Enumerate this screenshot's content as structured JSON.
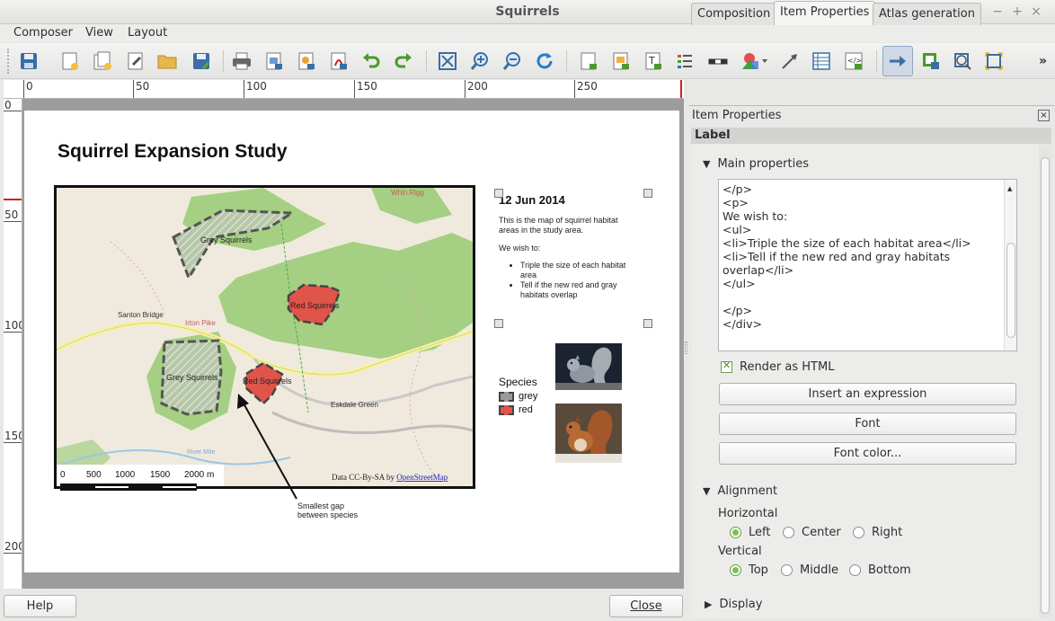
{
  "window": {
    "title": "Squirrels",
    "controls": [
      "−",
      "+",
      "×"
    ]
  },
  "menubar": [
    "Composer",
    "View",
    "Layout"
  ],
  "toolbar_icons": [
    "save-icon",
    "new-composer-icon",
    "duplicate-composer-icon",
    "composer-manager-icon",
    "open-template-icon",
    "save-template-icon",
    "print-icon",
    "export-image-icon",
    "export-svg-icon",
    "export-pdf-icon",
    "undo-icon",
    "redo-icon",
    "zoom-full-icon",
    "zoom-in-icon",
    "zoom-out-icon",
    "refresh-icon",
    "add-map-icon",
    "add-image-icon",
    "add-label-icon",
    "add-legend-icon",
    "add-scalebar-icon",
    "add-shape-icon",
    "add-arrow-icon",
    "add-table-icon",
    "add-html-icon",
    "select-move-item-icon",
    "move-content-icon",
    "edit-nodes-icon",
    "pan-icon",
    "more-icon"
  ],
  "ruler": {
    "h": [
      "0",
      "50",
      "100",
      "150",
      "200",
      "250"
    ],
    "v": [
      "0",
      "50",
      "100",
      "150",
      "200"
    ]
  },
  "composition": {
    "title": "Squirrel Expansion Study",
    "map": {
      "labels": {
        "whin_rigg": "Whin Rigg",
        "grey1": "Grey Squirrels",
        "red1": "Red Squirrels",
        "santon": "Santon Bridge",
        "irton": "Irton Pike",
        "grey2": "Grey Squirrels",
        "red2": "Red Squirrels",
        "eskdale": "Eskdale Green",
        "river": "River Mite"
      },
      "attribution_prefix": "Data CC-By-SA by ",
      "attribution_link": "OpenStreetMap",
      "scalebar": [
        "0",
        "500",
        "1000",
        "1500",
        "2000 m"
      ]
    },
    "label": {
      "date": "12 Jun 2014",
      "intro": "This is the map of squirrel habitat areas in the study area.",
      "wish": "We wish to:",
      "items": [
        "Triple the size of each habitat area",
        "Tell if the new red and gray habitats overlap"
      ]
    },
    "legend": {
      "title": "Species",
      "items": [
        {
          "label": "grey",
          "color": "#9a9a9a"
        },
        {
          "label": "red",
          "color": "#e0544a"
        }
      ]
    },
    "annotation": {
      "line1": "Smallest gap",
      "line2": "between species"
    }
  },
  "bottom": {
    "help": "Help",
    "close": "Close"
  },
  "panel": {
    "tabs": [
      "Composition",
      "Item Properties",
      "Atlas generation"
    ],
    "active_tab": "Item Properties",
    "header": "Item Properties",
    "section": "Label",
    "main_properties": "Main properties",
    "editor_lines": [
      "</p>",
      "<p>",
      "We wish to:",
      "<ul>",
      "<li>Triple the size of each habitat area</li>",
      "<li>Tell if the new red and gray habitats",
      "overlap</li>",
      "</ul>",
      "",
      "</p>",
      "</div>"
    ],
    "render_html": "Render as HTML",
    "render_html_checked": true,
    "insert_expression": "Insert an expression",
    "font": "Font",
    "font_color": "Font color...",
    "alignment": "Alignment",
    "horizontal": "Horizontal",
    "h_options": [
      "Left",
      "Center",
      "Right"
    ],
    "h_selected": "Left",
    "vertical": "Vertical",
    "v_options": [
      "Top",
      "Middle",
      "Bottom"
    ],
    "v_selected": "Top",
    "display": "Display"
  }
}
